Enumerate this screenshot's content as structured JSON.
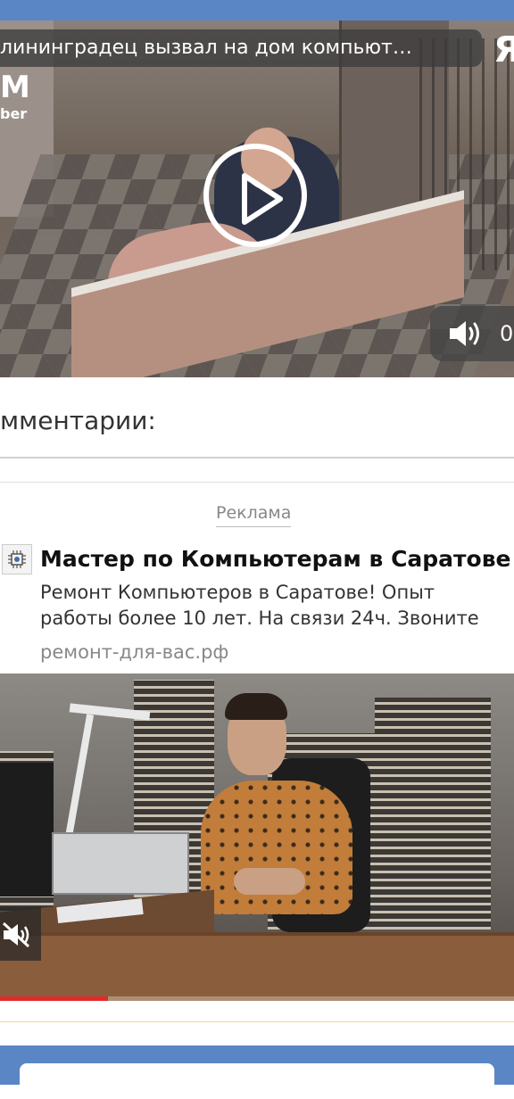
{
  "video": {
    "title": "…лининградец вызвал на дом компьют…",
    "title_visible": "лининградец вызвал на дом компьют…",
    "brand_glyph": "Я",
    "watermark": "М",
    "watermark_sub": "ber",
    "time": "0",
    "play_icon": "play-icon",
    "volume_icon": "volume-icon"
  },
  "comments": {
    "title": "мментарии:"
  },
  "ad": {
    "label": "Реклама",
    "title": "Мастер по Компьютерам в Саратове!",
    "desc_line1": "Ремонт Компьютеров в Саратове! Опыт",
    "desc_line2": "работы более 10 лет. На связи 24ч. Звоните",
    "url": "ремонт-для-вас.рф",
    "video_progress": 0.21,
    "mute_icon": "mute-icon"
  },
  "colors": {
    "brand_blue": "#5b86c5",
    "progress_red": "#e32a2a"
  }
}
